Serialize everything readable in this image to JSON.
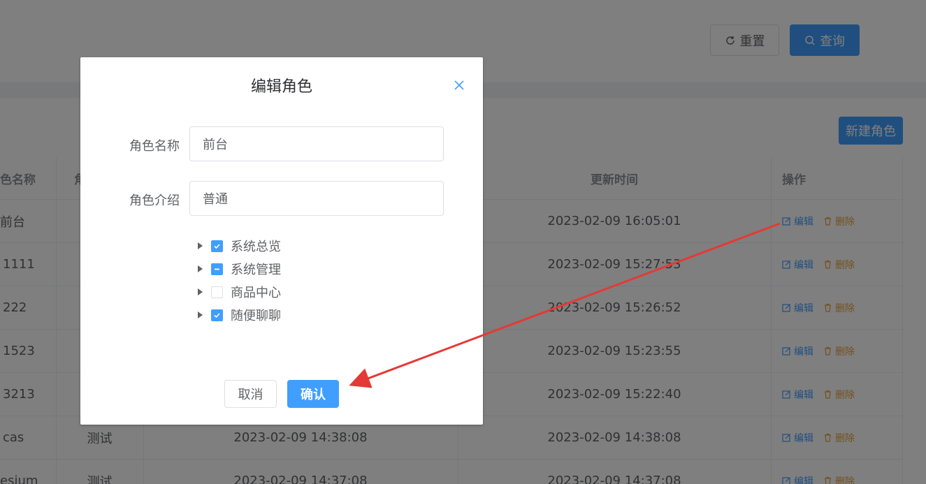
{
  "toolbar": {
    "reset_label": "重置",
    "query_label": "查询",
    "new_label": "新建角色"
  },
  "table": {
    "headers": {
      "name": "色名称",
      "desc": "角",
      "utime": "更新时间",
      "ops": "操作"
    },
    "edit_label": "编辑",
    "delete_label": "删除",
    "rows": [
      {
        "name": "前台",
        "desc": "",
        "ctime": "",
        "utime": "2023-02-09 16:05:01"
      },
      {
        "name": "1111",
        "desc": "",
        "ctime": "",
        "utime": "2023-02-09 15:27:53"
      },
      {
        "name": "222",
        "desc": "",
        "ctime": "",
        "utime": "2023-02-09 15:26:52"
      },
      {
        "name": "1523",
        "desc": "",
        "ctime": "",
        "utime": "2023-02-09 15:23:55"
      },
      {
        "name": "3213",
        "desc": "",
        "ctime": "",
        "utime": "2023-02-09 15:22:40"
      },
      {
        "name": "cas",
        "desc": "测试",
        "ctime": "2023-02-09 14:38:08",
        "utime": "2023-02-09 14:38:08"
      },
      {
        "name": "esium",
        "desc": "测试",
        "ctime": "2023-02-09 14:37:08",
        "utime": "2023-02-09 14:37:08"
      }
    ]
  },
  "dialog": {
    "title": "编辑角色",
    "name_label": "角色名称",
    "name_value": "前台",
    "desc_label": "角色介绍",
    "desc_value": "普通",
    "tree": [
      {
        "label": "系统总览",
        "state": "checked"
      },
      {
        "label": "系统管理",
        "state": "indeterminate"
      },
      {
        "label": "商品中心",
        "state": "unchecked"
      },
      {
        "label": "随便聊聊",
        "state": "checked"
      }
    ],
    "cancel_label": "取消",
    "confirm_label": "确认"
  },
  "colors": {
    "primary": "#409eff",
    "warning": "#e6a23c",
    "annotation_arrow": "#e53935"
  }
}
